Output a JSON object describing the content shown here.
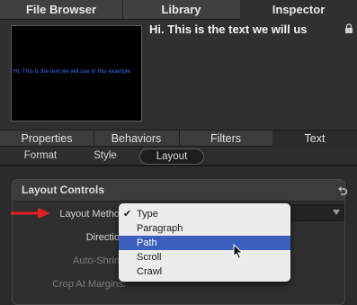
{
  "top_tabs": [
    "File Browser",
    "Library",
    "Inspector"
  ],
  "header": {
    "title": "Hi. This is the text we will us",
    "preview_text": "Hi. This is the text we will use in this example."
  },
  "section_tabs": [
    "Properties",
    "Behaviors",
    "Filters",
    "Text"
  ],
  "sub_tabs": [
    "Format",
    "Style",
    "Layout"
  ],
  "panel": {
    "title": "Layout Controls",
    "rows": {
      "layout_method": "Layout Metho",
      "direction": "Directio",
      "auto_shrink": "Auto-Shrin",
      "crop_at_margins": "Crop At Margins:"
    }
  },
  "menu": {
    "items": [
      "Type",
      "Paragraph",
      "Path",
      "Scroll",
      "Crawl"
    ],
    "checked": "Type",
    "highlighted": "Path",
    "check_mark": "✔"
  },
  "colors": {
    "arrow": "#e02020",
    "highlight": "#3b5fbd",
    "preview_text": "#3a6cff"
  }
}
